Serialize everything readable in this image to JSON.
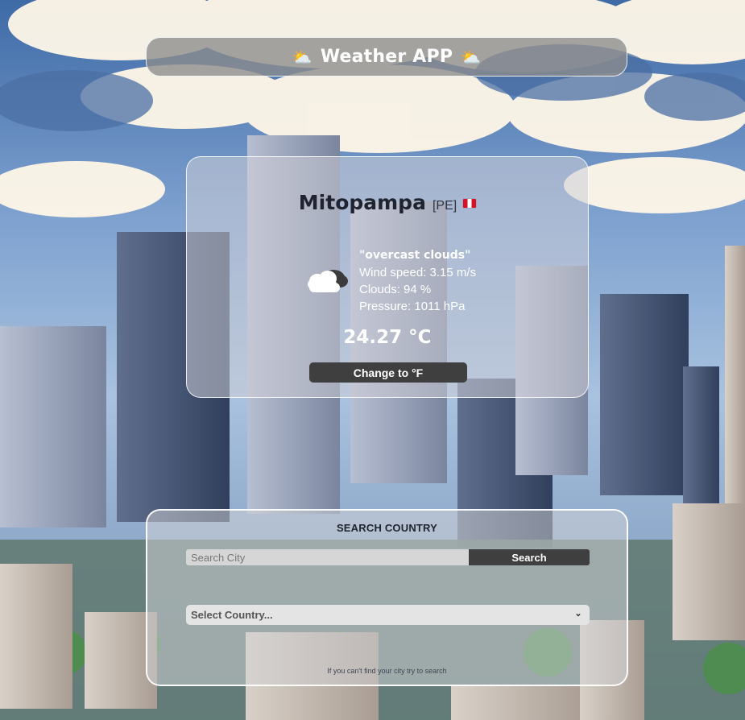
{
  "header": {
    "title": "Weather APP",
    "left_icon": "sun-behind-cloud-icon",
    "right_icon": "sun-behind-cloud-icon"
  },
  "weather": {
    "city": "Mitopampa",
    "country_code": "[PE]",
    "flag_icon": "peru-flag-icon",
    "description": "\"overcast clouds\"",
    "wind_speed": "Wind speed: 3.15 m/s",
    "clouds": "Clouds: 94 %",
    "pressure": "Pressure: 1011 hPa",
    "temperature": "24.27 °C",
    "weather_icon": "overcast-clouds-icon",
    "toggle_label": "Change to °F"
  },
  "search": {
    "title": "SEARCH COUNTRY",
    "input_placeholder": "Search City",
    "button_label": "Search",
    "select_value": "Select Country...",
    "hint": "If you can't find your city try to search"
  },
  "colors": {
    "panel_button": "#3f3f3f",
    "flag_red": "#d91023",
    "text_dark": "#1f2430",
    "text_light": "#ffffff"
  }
}
